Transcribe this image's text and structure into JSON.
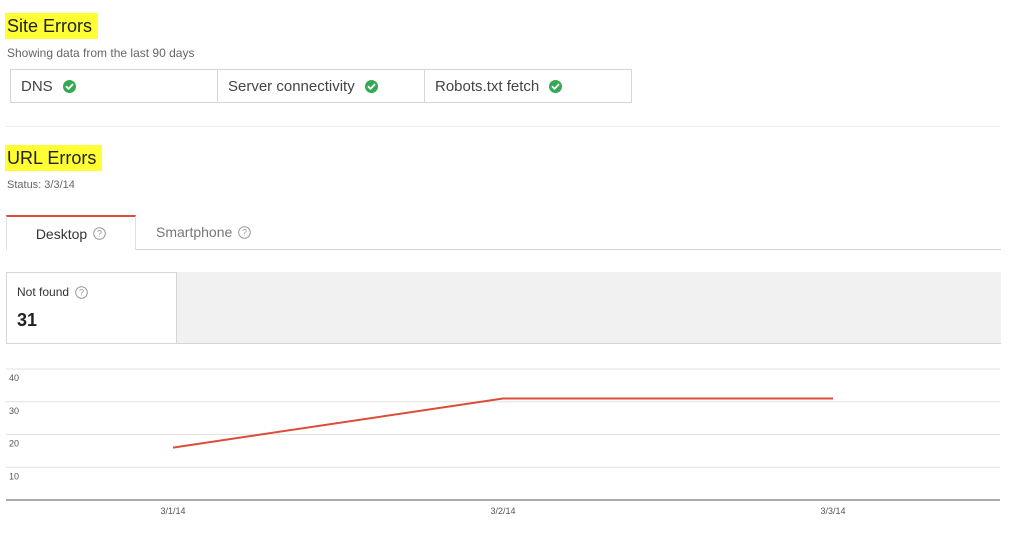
{
  "site_errors": {
    "title": "Site Errors",
    "subtitle": "Showing data from the last 90 days",
    "checks": [
      {
        "label": "DNS",
        "status": "ok"
      },
      {
        "label": "Server connectivity",
        "status": "ok"
      },
      {
        "label": "Robots.txt fetch",
        "status": "ok"
      }
    ]
  },
  "url_errors": {
    "title": "URL Errors",
    "status": "Status: 3/3/14",
    "tabs": [
      {
        "label": "Desktop",
        "active": true
      },
      {
        "label": "Smartphone",
        "active": false
      }
    ],
    "metric": {
      "label": "Not found",
      "value": "31"
    }
  },
  "colors": {
    "highlight": "#ffff33",
    "ok_check": "#34a853",
    "series_line": "#dd4b39",
    "active_tab_accent": "#dd4b39"
  },
  "chart_data": {
    "type": "line",
    "categories": [
      "3/1/14",
      "3/2/14",
      "3/3/14"
    ],
    "series": [
      {
        "values": [
          16,
          31,
          31
        ]
      }
    ],
    "y_ticks": [
      10,
      20,
      30,
      40
    ],
    "ylim": [
      0,
      40
    ],
    "grid": true
  }
}
